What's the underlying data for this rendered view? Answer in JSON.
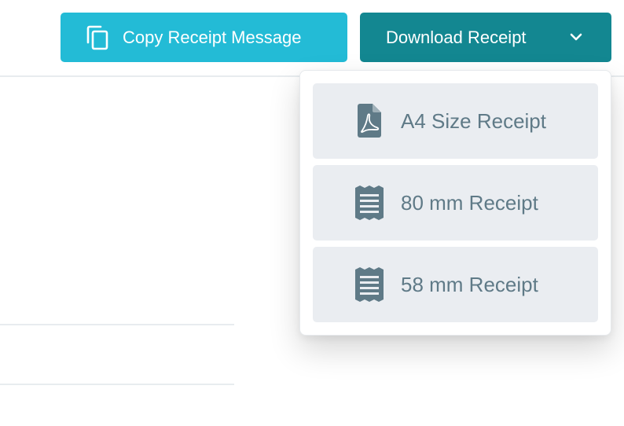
{
  "toolbar": {
    "copy_label": "Copy Receipt Message",
    "download_label": "Download Receipt"
  },
  "dropdown": {
    "items": [
      {
        "label": "A4 Size Receipt",
        "icon": "pdf-file-icon"
      },
      {
        "label": "80 mm Receipt",
        "icon": "receipt-icon"
      },
      {
        "label": "58 mm Receipt",
        "icon": "receipt-icon"
      }
    ]
  },
  "colors": {
    "copy_button": "#23bbd6",
    "download_button": "#138791",
    "menu_item_bg": "#eaedf1",
    "menu_item_text": "#5f7a87"
  }
}
